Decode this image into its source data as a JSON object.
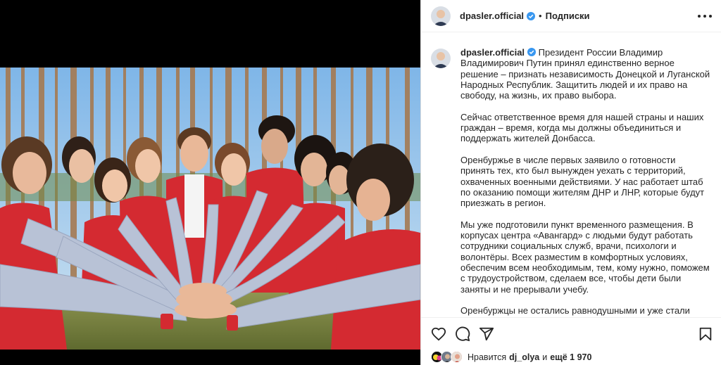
{
  "post": {
    "username": "dpasler.official",
    "separator": "•",
    "follow_label": "Подписки",
    "caption_paragraphs": [
      "Президент России Владимир Владимирович Путин принял единственно верное решение – признать независимость Донецкой и Луганской Народных Республик. Защитить людей и их право на свободу, на жизнь, их право выбора.",
      "Сейчас ответственное время для нашей страны и наших граждан – время, когда мы должны объединиться и поддержать жителей Донбасса.",
      "Оренбуржье в числе первых заявило о готовности принять тех, кто был вынужден уехать с территорий, охваченных военными действиями. У нас работает штаб по оказанию помощи жителям ДНР и ЛНР, которые будут приезжать в регион.",
      "Мы уже подготовили пункт временного размещения. В корпусах центра «Авангард» с людьми будут работать сотрудники социальных служб, врачи, психологи и волонтёры. Всех разместим в комфортных условиях, обеспечим всем необходимым, тем, кому нужно, поможем с трудоустройством, сделаем все, чтобы дети были заняты и не прерывали учебу.",
      "Оренбуржцы не остались равнодушными и уже стали активно собирать гуманитарную помощь. Спасибо всем за такой живой отклик!"
    ]
  },
  "likes": {
    "prefix": "Нравится",
    "liker": "dj_olya",
    "middle": "и",
    "others": "ещё 1 970"
  },
  "icons": {
    "verified": "verified-badge-icon",
    "more": "more-options-icon",
    "like": "heart-icon",
    "comment": "comment-icon",
    "share": "share-icon",
    "save": "bookmark-icon"
  },
  "colors": {
    "verified": "#3897f0",
    "text": "#262626",
    "jacket_red": "#d42a31",
    "sleeve_grey": "#b8c2d6"
  }
}
